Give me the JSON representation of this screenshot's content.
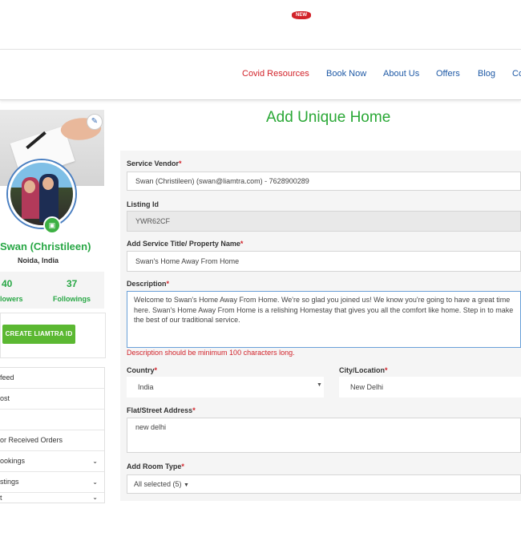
{
  "nav": {
    "covid_label": "Covid Resources",
    "new_badge": "NEW",
    "book_label": "Book Now",
    "about_label": "About Us",
    "offers_label": "Offers",
    "blog_label": "Blog",
    "contact_label": "Co"
  },
  "profile": {
    "name": "Swan (Christileen)",
    "location": "Noida, India",
    "followers_count": "40",
    "followers_label": "lowers",
    "followings_count": "37",
    "followings_label": "Followings",
    "create_button": "CREATE LIAMTRA ID"
  },
  "sidebar": {
    "items": [
      {
        "label": "feed"
      },
      {
        "label": "ost"
      },
      {
        "label": ""
      },
      {
        "label": "or Received Orders"
      },
      {
        "label": "ookings",
        "chevron": "⌄"
      },
      {
        "label": "stings",
        "chevron": "⌄"
      },
      {
        "label": "t",
        "chevron": "⌄"
      }
    ]
  },
  "form": {
    "title": "Add Unique Home",
    "vendor_label": "Service Vendor",
    "vendor_value": "Swan (Christileen) (swan@liamtra.com) - 7628900289",
    "listing_label": "Listing Id",
    "listing_value": "YWR62CF",
    "service_title_label": "Add Service Title/ Property Name",
    "service_title_value": "Swan's Home Away From Home",
    "description_label": "Description",
    "description_value": "Welcome to Swan's Home Away From Home. We're so glad you joined us! We know you're going to have a great time here. Swan's Home Away From Home is a relishing Homestay that gives you all the comfort like home. Step in to make the best of our traditional service.",
    "description_error": "Description should be minimum 100 characters long.",
    "country_label": "Country",
    "country_value": "India",
    "city_label": "City/Location",
    "city_value": "New Delhi",
    "address_label": "Flat/Street Address",
    "address_value": "new delhi",
    "room_type_label": "Add Room Type",
    "room_type_value": "All selected (5)",
    "required_mark": "*"
  },
  "icons": {
    "edit": "edit-icon",
    "camera": "camera-icon",
    "chevron": "chevron-down-icon"
  },
  "colors": {
    "accent_green": "#2aa836",
    "nav_blue": "#1f5aa6",
    "error_red": "#d2232a"
  }
}
